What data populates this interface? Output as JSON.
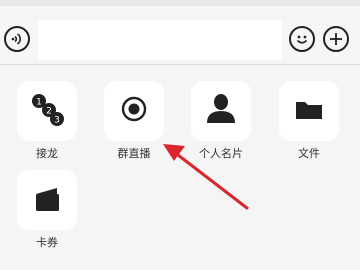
{
  "toolbar": {
    "input_value": "",
    "voice_icon": "voice-wave-icon",
    "emoji_icon": "emoji-smile-icon",
    "plus_icon": "plus-icon"
  },
  "panel": {
    "items": [
      {
        "label": "接龙",
        "icon": "numbered-chain-icon"
      },
      {
        "label": "群直播",
        "icon": "record-live-icon"
      },
      {
        "label": "个人名片",
        "icon": "person-card-icon"
      },
      {
        "label": "文件",
        "icon": "folder-icon"
      },
      {
        "label": "卡券",
        "icon": "wallet-coupon-icon"
      }
    ],
    "chain_numbers": [
      "1",
      "2",
      "3"
    ]
  },
  "colors": {
    "annotation_arrow": "#d9272c",
    "icon_dark": "#222222",
    "panel_bg": "#f5f5f5",
    "tile_bg": "#ffffff"
  }
}
